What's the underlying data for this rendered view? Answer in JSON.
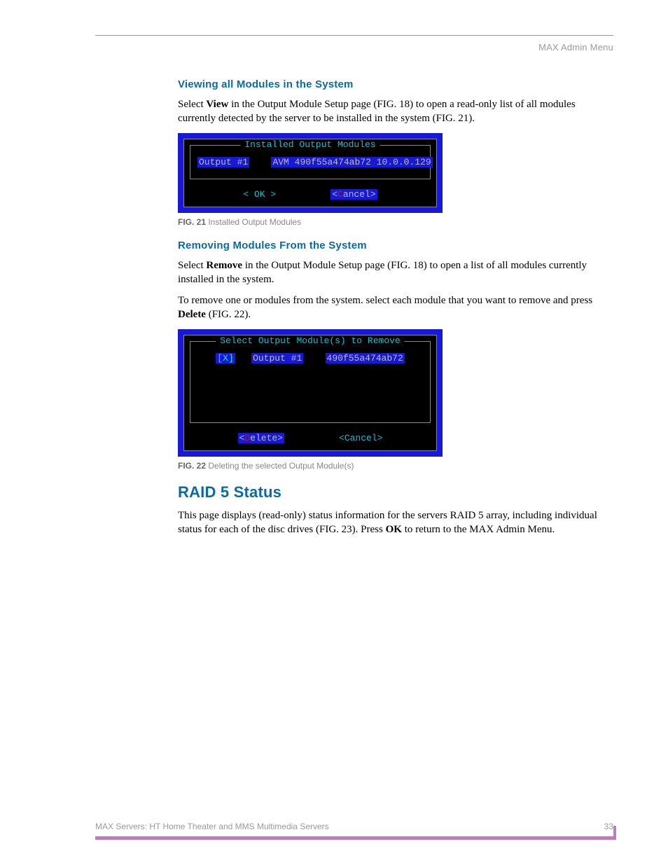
{
  "header": {
    "right": "MAX Admin Menu"
  },
  "sections": {
    "viewAll": {
      "heading": "Viewing all Modules in the System",
      "p1_pre": "Select ",
      "p1_bold": "View",
      "p1_post": " in the Output Module Setup page (FIG. 18) to open a read-only list of all modules currently detected by the server to be installed in the system (FIG. 21)."
    },
    "removing": {
      "heading": "Removing Modules From the System",
      "p1_pre": "Select ",
      "p1_bold": "Remove",
      "p1_post": " in the Output Module Setup page (FIG. 18) to open a list of all modules currently installed in the system.",
      "p2_pre": "To remove one or modules from the system. select each module that you want to remove and press ",
      "p2_bold": "Delete",
      "p2_post": " (FIG. 22)."
    },
    "raid": {
      "heading": "RAID 5 Status",
      "p1_a": "This page displays (read-only) status information for the servers RAID 5 array, including individual status for each of the disc drives (FIG. 23). Press ",
      "p1_bold": "OK",
      "p1_b": " to return to the MAX Admin Menu."
    }
  },
  "fig21": {
    "title": "Installed Output Modules",
    "row": {
      "label": "Output #1",
      "value": "AVM 490f55a474ab72 10.0.0.129"
    },
    "btn_ok": "<  OK  >",
    "btn_cancel_pre": "<",
    "btn_cancel_letter": "C",
    "btn_cancel_post": "ancel>",
    "caption_label": "FIG. 21",
    "caption_text": "  Installed Output Modules"
  },
  "fig22": {
    "title": "Select Output Module(s) to Remove",
    "row": {
      "mark": "[X]",
      "label": "Output #1",
      "value": "490f55a474ab72"
    },
    "btn_delete_pre": "<",
    "btn_delete_letter": "D",
    "btn_delete_post": "elete>",
    "btn_cancel": "<Cancel>",
    "caption_label": "FIG. 22",
    "caption_text": "  Deleting the selected Output Module(s)"
  },
  "footer": {
    "left": "MAX Servers: HT Home Theater and MMS Multimedia Servers",
    "page": "33"
  }
}
